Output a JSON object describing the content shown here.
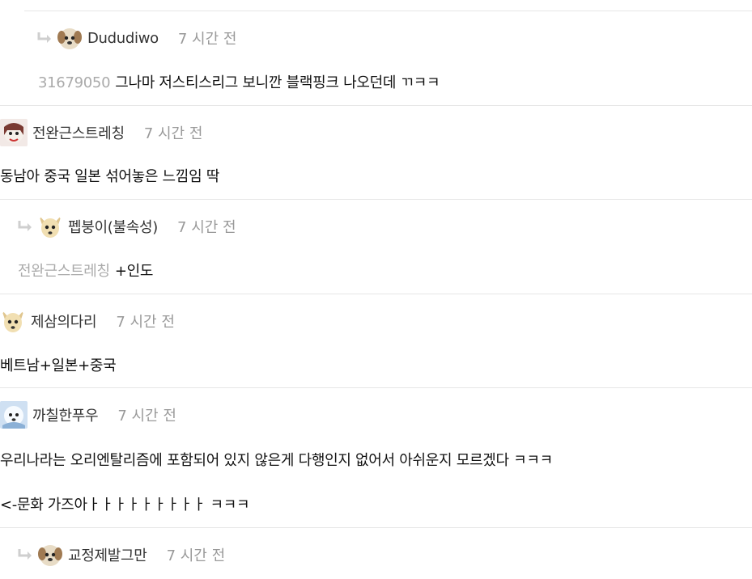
{
  "comments": [
    {
      "author": "Dududiwo",
      "time": "7 시간 전",
      "reply_ref": "31679050",
      "text": "그나마 저스티스리그 보니깐 블랙핑크 나오던데 ㄲㅋㅋ"
    },
    {
      "author": "전완근스트레칭",
      "time": "7 시간 전",
      "text": "동남아 중국 일본 섞어놓은 느낌임 딱"
    },
    {
      "author": "펩붕이(불속성)",
      "time": "7 시간 전",
      "reply_ref": "전완근스트레칭",
      "text": "+인도"
    },
    {
      "author": "제삼의다리",
      "time": "7 시간 전",
      "text": "베트남+일본+중국"
    },
    {
      "author": "까칠한푸우",
      "time": "7 시간 전",
      "text": "우리나라는 오리엔탈리즘에 포함되어 있지 않은게 다행인지 없어서 아쉬운지 모르겠다 ㅋㅋㅋ",
      "text2": "<-문화 가즈아ㅏㅏㅏㅏㅏㅏㅏㅏㅏ ㅋㅋㅋ"
    },
    {
      "author": "교정제발그만",
      "time": "7 시간 전"
    }
  ],
  "colors": {
    "divider": "#e6e6e6",
    "time": "#999999",
    "ref": "#aaaaaa"
  },
  "icons": {
    "reply": "reply-arrow-icon"
  }
}
